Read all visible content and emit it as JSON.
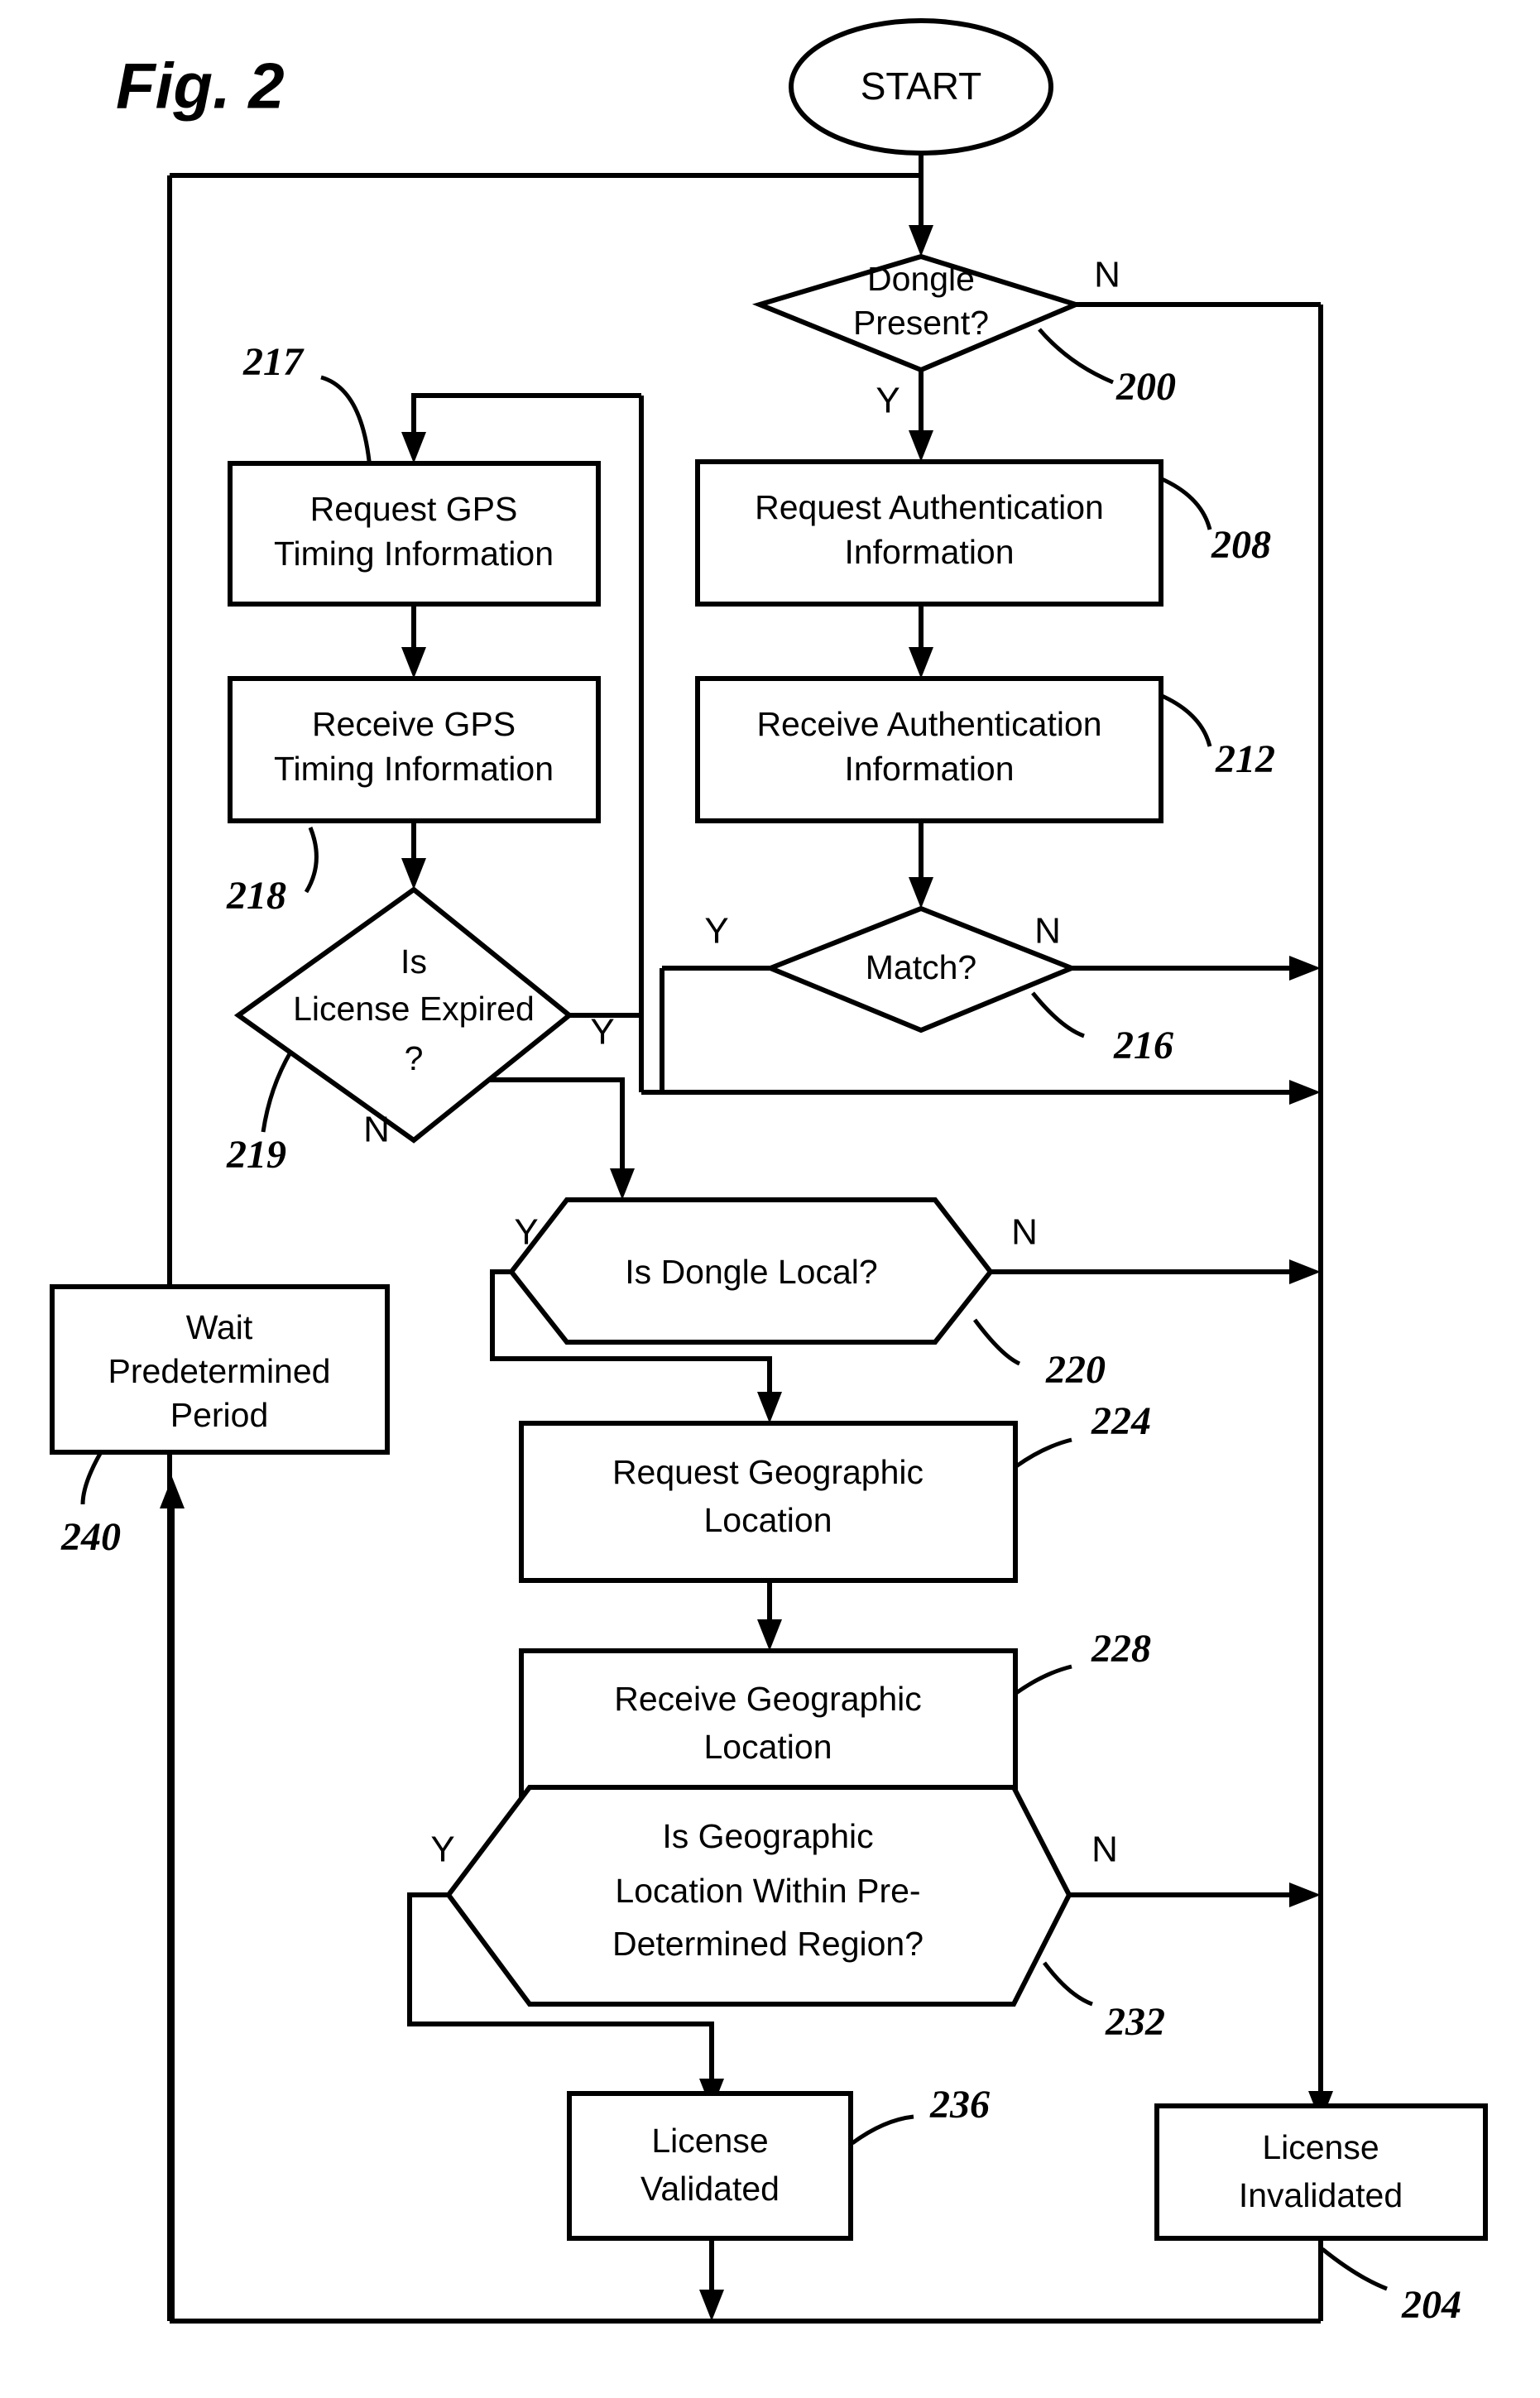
{
  "figure": {
    "title": "Fig. 2",
    "type": "patent-flowchart"
  },
  "nodes": {
    "start": {
      "label": "START",
      "shape": "ellipse"
    },
    "dongle_present": {
      "label_line1": "Dongle",
      "label_line2": "Present?",
      "shape": "diamond",
      "ref": "200",
      "yes": "Y",
      "no": "N"
    },
    "request_gps": {
      "label_line1": "Request GPS",
      "label_line2": "Timing Information",
      "shape": "rect",
      "ref": "217"
    },
    "receive_gps": {
      "label_line1": "Receive GPS",
      "label_line2": "Timing Information",
      "shape": "rect",
      "ref": "218"
    },
    "request_auth": {
      "label_line1": "Request Authentication",
      "label_line2": "Information",
      "shape": "rect",
      "ref": "208"
    },
    "receive_auth": {
      "label_line1": "Receive Authentication",
      "label_line2": "Information",
      "shape": "rect",
      "ref": "212"
    },
    "license_expired": {
      "label_line1": "Is",
      "label_line2": "License Expired",
      "label_line3": "?",
      "shape": "diamond",
      "ref": "219",
      "yes": "Y",
      "no": "N"
    },
    "match": {
      "label_line1": "Match?",
      "shape": "diamond",
      "ref": "216",
      "yes": "Y",
      "no": "N"
    },
    "dongle_local": {
      "label_line1": "Is Dongle Local?",
      "shape": "hexagon",
      "ref": "220",
      "yes": "Y",
      "no": "N"
    },
    "wait_period": {
      "label_line1": "Wait",
      "label_line2": "Predetermined",
      "label_line3": "Period",
      "shape": "rect",
      "ref": "240"
    },
    "request_geo": {
      "label_line1": "Request Geographic",
      "label_line2": "Location",
      "shape": "rect",
      "ref": "224"
    },
    "receive_geo": {
      "label_line1": "Receive Geographic",
      "label_line2": "Location",
      "shape": "rect",
      "ref": "228"
    },
    "geo_region": {
      "label_line1": "Is Geographic",
      "label_line2": "Location Within Pre-",
      "label_line3": "Determined Region?",
      "shape": "hexagon",
      "ref": "232",
      "yes": "Y",
      "no": "N"
    },
    "license_validated": {
      "label_line1": "License",
      "label_line2": "Validated",
      "shape": "rect",
      "ref": "236"
    },
    "license_invalidated": {
      "label_line1": "License",
      "label_line2": "Invalidated",
      "shape": "rect",
      "ref": "204"
    }
  },
  "colors": {
    "stroke": "#000000",
    "fill": "#ffffff",
    "background": "#ffffff"
  }
}
